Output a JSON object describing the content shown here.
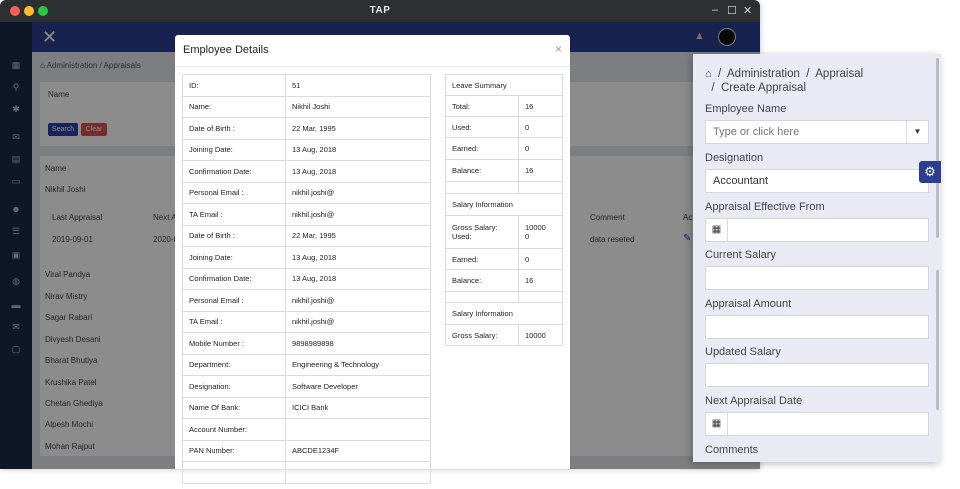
{
  "window": {
    "title": "TAP",
    "controls": [
      "–",
      "☐",
      "✕"
    ]
  },
  "app": {
    "breadcrumb": "Administration  /  Appraisals",
    "filter": {
      "name_label": "Name",
      "search_label": "Search",
      "clear_label": "Clear"
    },
    "list": {
      "header": "Name",
      "first_employee": "Nikhil Joshi",
      "sub_headers": {
        "last_appraisal": "Last Appraisal",
        "next": "Next A",
        "comment": "Comment",
        "action": "Act"
      },
      "sub_row": {
        "last_appraisal": "2019-09-01",
        "next": "2020-0",
        "comment": "data reseted"
      },
      "employees": [
        "Viral Pandya",
        "Nirav Mistry",
        "Sagar Rabari",
        "Divyesh Desani",
        "Bharat Bhutiya",
        "Krushika Patel",
        "Chetan Ghediya",
        "Alpesh Mochi",
        "Mohan Rajput"
      ]
    }
  },
  "modal": {
    "title": "Employee Details",
    "close": "×",
    "details": [
      {
        "k": "ID:",
        "v": "51"
      },
      {
        "k": "Name:",
        "v": "Nikhil Joshi"
      },
      {
        "k": "Date of Birth :",
        "v": "22 Mar, 1995"
      },
      {
        "k": "Joining Date:",
        "v": "13 Aug, 2018"
      },
      {
        "k": "Confirmation Date:",
        "v": "13 Aug, 2018"
      },
      {
        "k": "Personal Email :",
        "v": "nikhil.joshi@"
      },
      {
        "k": "TA Email :",
        "v": "nikhil.joshi@"
      },
      {
        "k": "Date of Birth :",
        "v": "22 Mar, 1995"
      },
      {
        "k": "Joining Date:",
        "v": "13 Aug, 2018"
      },
      {
        "k": "Confirmation Date:",
        "v": "13 Aug, 2018"
      },
      {
        "k": "Personal Email :",
        "v": "nikhil.joshi@"
      },
      {
        "k": "TA Email :",
        "v": "nikhil.joshi@"
      },
      {
        "k": "Mobile Number :",
        "v": "9898989898"
      },
      {
        "k": "Department:",
        "v": "Engineering & Technology"
      },
      {
        "k": "Designation:",
        "v": "Software Developer"
      },
      {
        "k": "Name Of Bank:",
        "v": "ICICI Bank"
      },
      {
        "k": "Account Number:",
        "v": ""
      },
      {
        "k": "PAN Number:",
        "v": "ABCDE1234F"
      }
    ],
    "summary": {
      "leave_title": "Leave Summary",
      "total_label": "Total:",
      "total": "16",
      "used_label": "Used:",
      "used": "0",
      "earned_label": "Earned:",
      "earned": "0",
      "balance_label": "Balance:",
      "balance": "16",
      "salary_title": "Salary Information",
      "gross_label": "Gross Salary:",
      "gross": "10000",
      "used2_label": "Used:",
      "used2": "0",
      "earned2_label": "Earned:",
      "earned2": "0",
      "balance2_label": "Balance:",
      "balance2": "16",
      "salary_title2": "Salary Information",
      "gross2_label": "Gross Salary:",
      "gross2": "10000"
    }
  },
  "panel": {
    "breadcrumb_1": "Administration",
    "breadcrumb_2": "Appraisal",
    "breadcrumb_3": "Create Appraisal",
    "sep": "/",
    "employee_label": "Employee Name",
    "employee_placeholder": "Type or click here",
    "designation_label": "Designation",
    "designation_value": "Accountant",
    "effective_label": "Appraisal Effective From",
    "current_salary_label": "Current Salary",
    "amount_label": "Appraisal Amount",
    "updated_label": "Updated Salary",
    "next_date_label": "Next Appraisal Date",
    "comments_label": "Comments"
  }
}
